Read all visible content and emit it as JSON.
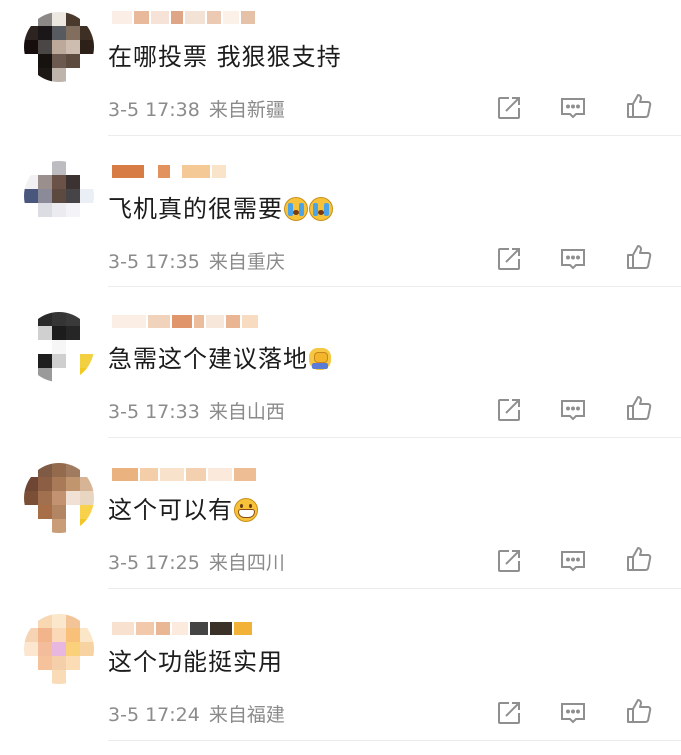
{
  "comments": [
    {
      "text": "在哪投票 我狠狠支持",
      "time": "3-5 17:38",
      "source": "来自新疆",
      "emojis": []
    },
    {
      "text": "飞机真的很需要",
      "time": "3-5 17:35",
      "source": "来自重庆",
      "emojis": [
        "crying-face",
        "crying-face"
      ]
    },
    {
      "text": "急需这个建议落地",
      "time": "3-5 17:33",
      "source": "来自山西",
      "emojis": [
        "facepalm"
      ]
    },
    {
      "text": "这个可以有",
      "time": "3-5 17:25",
      "source": "来自四川",
      "emojis": [
        "grinning-face"
      ]
    },
    {
      "text": "这个功能挺实用",
      "time": "3-5 17:24",
      "source": "来自福建",
      "emojis": []
    }
  ],
  "actions": {
    "repost_icon": "repost-icon",
    "comment_icon": "comment-icon",
    "like_icon": "thumbs-up-icon"
  },
  "colors": {
    "meta_text": "#8b8b8b",
    "icon_stroke": "#8f8f8f",
    "divider": "#ececec"
  }
}
